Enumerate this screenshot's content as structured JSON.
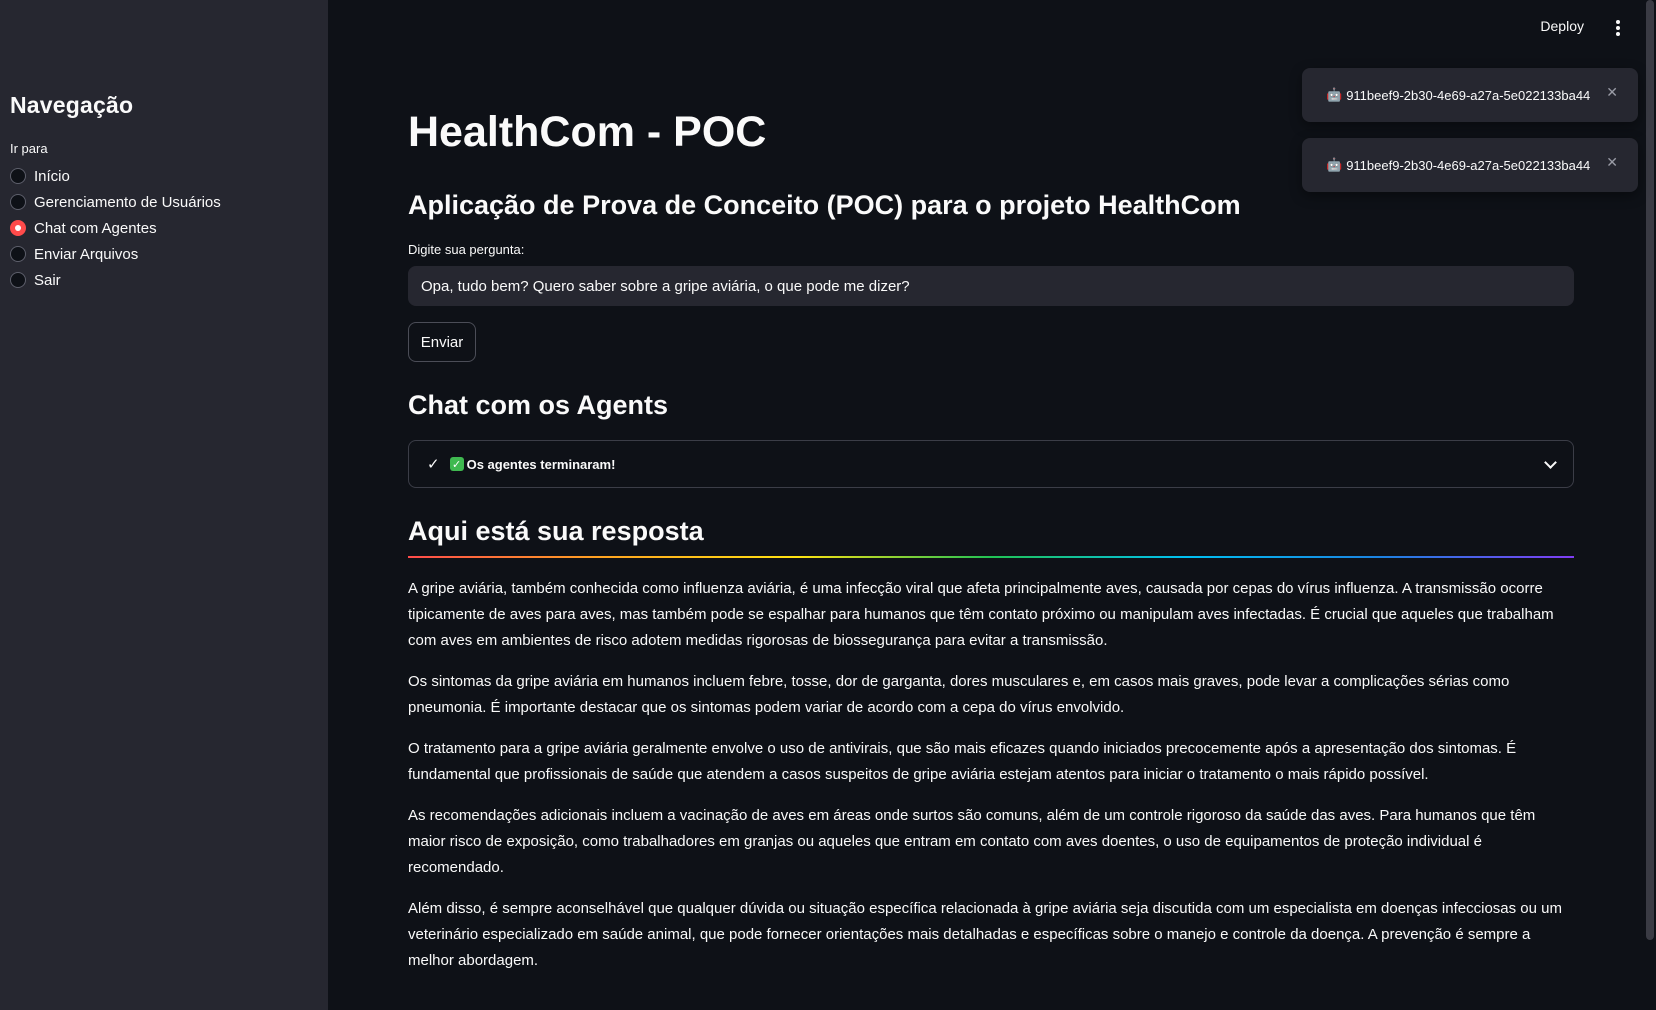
{
  "header": {
    "deploy_label": "Deploy",
    "menu_icon": "kebab-menu-icon"
  },
  "sidebar": {
    "title": "Navegação",
    "radio_label": "Ir para",
    "items": [
      {
        "label": "Início",
        "selected": false
      },
      {
        "label": "Gerenciamento de Usuários",
        "selected": false
      },
      {
        "label": "Chat com Agentes",
        "selected": true
      },
      {
        "label": "Enviar Arquivos",
        "selected": false
      },
      {
        "label": "Sair",
        "selected": false
      }
    ]
  },
  "toasts": [
    {
      "icon": "🤖",
      "text": "911beef9-2b30-4e69-a27a-5e022133ba44",
      "close": "✕"
    },
    {
      "icon": "🤖",
      "text": "911beef9-2b30-4e69-a27a-5e022133ba44",
      "close": "✕"
    }
  ],
  "main": {
    "title": "HealthCom - POC",
    "subtitle": "Aplicação de Prova de Conceito (POC) para o projeto HealthCom",
    "input_label": "Digite sua pergunta:",
    "input_value": "Opa, tudo bem? Quero saber sobre a gripe aviária, o que pode me dizer?",
    "send_label": "Enviar",
    "chat_heading": "Chat com os Agents",
    "expander_check": "✓",
    "expander_emoji": "✓",
    "expander_label": "Os agentes terminaram!",
    "answer_heading": "Aqui está sua resposta",
    "answer_paragraphs": [
      "A gripe aviária, também conhecida como influenza aviária, é uma infecção viral que afeta principalmente aves, causada por cepas do vírus influenza. A transmissão ocorre tipicamente de aves para aves, mas também pode se espalhar para humanos que têm contato próximo ou manipulam aves infectadas. É crucial que aqueles que trabalham com aves em ambientes de risco adotem medidas rigorosas de biossegurança para evitar a transmissão.",
      "Os sintomas da gripe aviária em humanos incluem febre, tosse, dor de garganta, dores musculares e, em casos mais graves, pode levar a complicações sérias como pneumonia. É importante destacar que os sintomas podem variar de acordo com a cepa do vírus envolvido.",
      "O tratamento para a gripe aviária geralmente envolve o uso de antivirais, que são mais eficazes quando iniciados precocemente após a apresentação dos sintomas. É fundamental que profissionais de saúde que atendem a casos suspeitos de gripe aviária estejam atentos para iniciar o tratamento o mais rápido possível.",
      "As recomendações adicionais incluem a vacinação de aves em áreas onde surtos são comuns, além de um controle rigoroso da saúde das aves. Para humanos que têm maior risco de exposição, como trabalhadores em granjas ou aqueles que entram em contato com aves doentes, o uso de equipamentos de proteção individual é recomendado.",
      "Além disso, é sempre aconselhável que qualquer dúvida ou situação específica relacionada à gripe aviária seja discutida com um especialista em doenças infecciosas ou um veterinário especializado em saúde animal, que pode fornecer orientações mais detalhadas e específicas sobre o manejo e controle da doença. A prevenção é sempre a melhor abordagem."
    ]
  },
  "colors": {
    "background": "#0e1117",
    "sidebar": "#262730",
    "accent": "#ff4b4b"
  }
}
